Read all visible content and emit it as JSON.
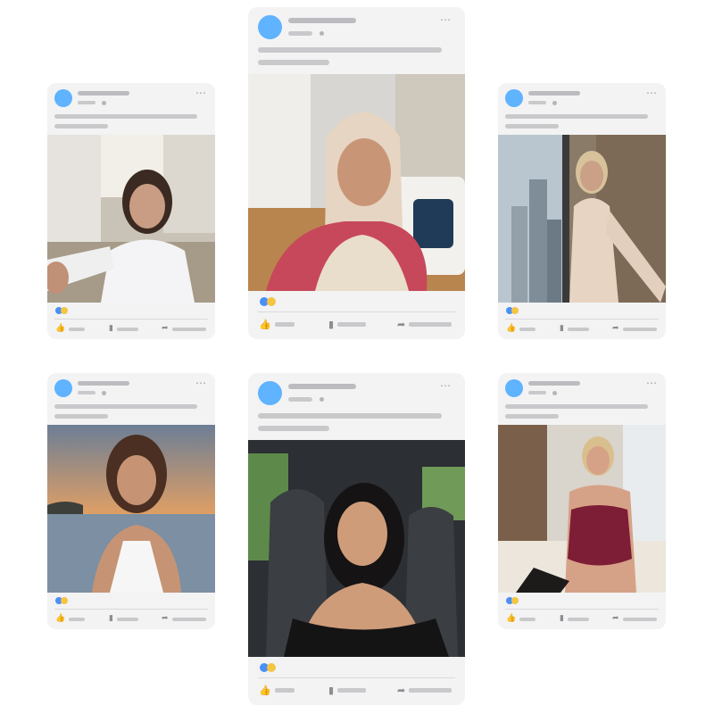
{
  "colors": {
    "card_bg": "#f3f3f4",
    "avatar": "#5fb3ff",
    "placeholder_line": "#c9c9cc",
    "reaction_like": "#4a90f5",
    "reaction_love": "#f5c542"
  },
  "icons": {
    "more": "⋯",
    "like": "👍",
    "comment": "▮",
    "share": "➦"
  },
  "posts": [
    {
      "id": "post-1",
      "photo": "selfie-indoor-white-robe"
    },
    {
      "id": "post-2",
      "photo": "selfie-hijab-living-room"
    },
    {
      "id": "post-3",
      "photo": "window-city-view-satin"
    },
    {
      "id": "post-4",
      "photo": "sunset-sea-white-top"
    },
    {
      "id": "post-5",
      "photo": "car-selfie-black-top"
    },
    {
      "id": "post-6",
      "photo": "bedroom-lace-corset"
    }
  ]
}
